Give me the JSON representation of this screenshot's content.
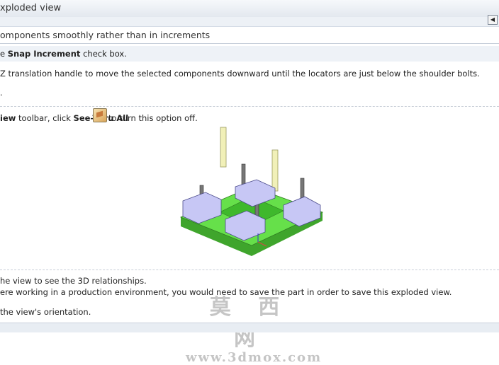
{
  "window": {
    "title": "xploded view"
  },
  "section": {
    "heading": "omponents smoothly rather than in increments"
  },
  "steps": {
    "s1": {
      "prefix": "e ",
      "bold": "Snap Increment",
      "suffix": " check box."
    },
    "s2": {
      "text": "Z translation handle to move the selected components downward until the locators are just below the shoulder bolts."
    },
    "s3": {
      "text": "."
    },
    "s4": {
      "bold1": "iew",
      "mid": " toolbar, click ",
      "bold2": "See-Thru All",
      "suffix": " to turn this option off."
    },
    "s5": {
      "text": "he view to see the 3D relationships."
    },
    "s6": {
      "text": "ere working in a production environment, you would need to save the part in order to save this exploded view."
    },
    "s7": {
      "text": "the view's orientation."
    }
  },
  "icons": {
    "collapse": "collapse-left-icon",
    "see_thru": "see-thru-all-icon"
  },
  "watermark": {
    "line1": "莫 西 网",
    "line2": "www.3dmox.com"
  }
}
